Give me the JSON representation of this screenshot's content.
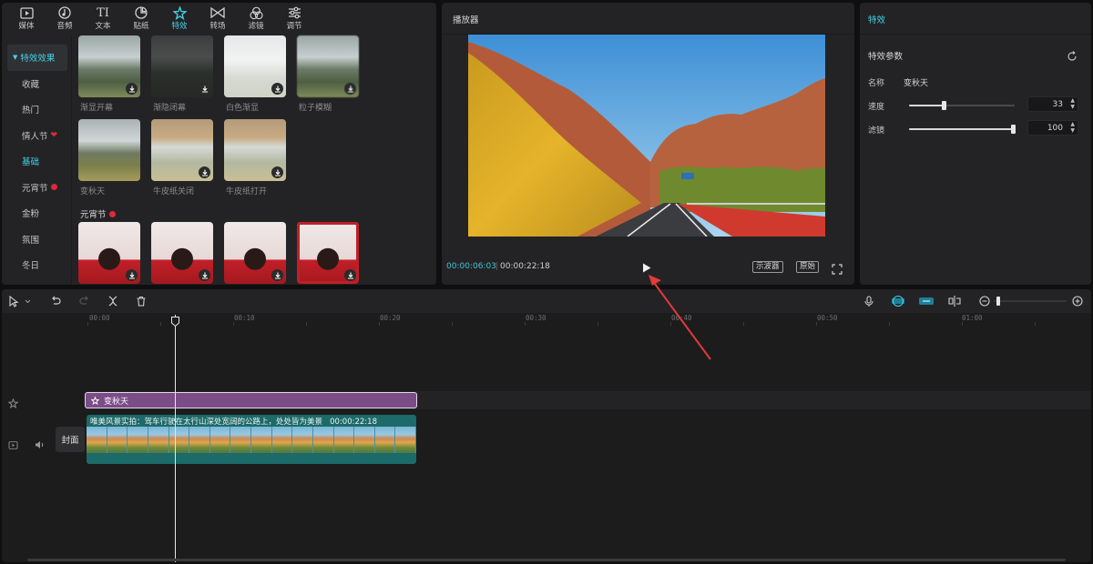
{
  "top_tabs": [
    {
      "label": "媒体",
      "icon": "media-icon"
    },
    {
      "label": "音频",
      "icon": "audio-icon"
    },
    {
      "label": "文本",
      "icon": "text-icon"
    },
    {
      "label": "贴纸",
      "icon": "sticker-icon"
    },
    {
      "label": "特效",
      "icon": "effects-icon",
      "active": true
    },
    {
      "label": "转场",
      "icon": "transition-icon"
    },
    {
      "label": "滤镜",
      "icon": "filter-icon"
    },
    {
      "label": "调节",
      "icon": "adjust-icon"
    }
  ],
  "categories": [
    "特效效果",
    "收藏",
    "热门",
    "情人节",
    "基础",
    "元宵节",
    "金粉",
    "氛围",
    "冬日"
  ],
  "effects_row1": [
    "渐显开幕",
    "渐隐闭幕",
    "白色渐显",
    "粒子模糊"
  ],
  "effects_row2": [
    "变秋天",
    "牛皮纸关闭",
    "牛皮纸打开"
  ],
  "section_title": "元宵节",
  "player": {
    "title": "播放器",
    "current_time": "00:00:06:03",
    "total_time": "00:00:22:18",
    "oscilloscope_label": "示波器",
    "original_label": "原始"
  },
  "effect_panel": {
    "title": "特效",
    "params_title": "特效参数",
    "name_label": "名称",
    "name_value": "变秋天",
    "speed_label": "速度",
    "speed_value": "33",
    "filter_label": "滤镜",
    "filter_value": "100",
    "speed_fraction": 0.33,
    "filter_fraction": 1.0
  },
  "timeline": {
    "ticks": [
      "00:00",
      "00:10",
      "00:20",
      "00:30",
      "00:40",
      "00:50",
      "01:00"
    ],
    "effect_clip_label": "变秋天",
    "video_clip_label": "唯美风景实拍：驾车行驶在太行山深处宽阔的公路上，处处皆为美景",
    "video_clip_duration": "00:00:22:18",
    "cover_label": "封面"
  },
  "colors": {
    "accent": "#45d3e6",
    "effect_clip": "#7a4d86",
    "video_clip": "#1c6a6a",
    "annotation_arrow": "#e23a3a"
  }
}
